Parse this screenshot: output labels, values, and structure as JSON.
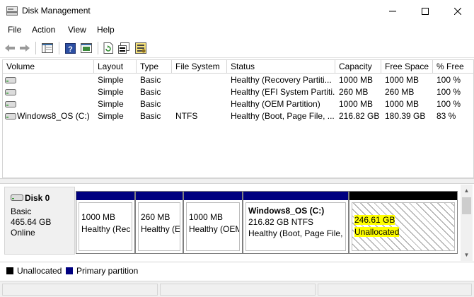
{
  "window": {
    "title": "Disk Management",
    "icon": "disk-management-icon"
  },
  "menu": [
    "File",
    "Action",
    "View",
    "Help"
  ],
  "toolbar": {
    "buttons": [
      "back-arrow-icon",
      "forward-arrow-icon",
      "list-view-icon",
      "help-icon",
      "console-tree-icon",
      "refresh-icon",
      "properties-icon",
      "settings-icon"
    ]
  },
  "volume_list": {
    "columns": [
      "Volume",
      "Layout",
      "Type",
      "File System",
      "Status",
      "Capacity",
      "Free Space",
      "% Free"
    ],
    "rows": [
      {
        "volume": "",
        "layout": "Simple",
        "type": "Basic",
        "fs": "",
        "status": "Healthy (Recovery Partiti...",
        "capacity": "1000 MB",
        "free": "1000 MB",
        "pct": "100 %"
      },
      {
        "volume": "",
        "layout": "Simple",
        "type": "Basic",
        "fs": "",
        "status": "Healthy (EFI System Partiti...",
        "capacity": "260 MB",
        "free": "260 MB",
        "pct": "100 %"
      },
      {
        "volume": "",
        "layout": "Simple",
        "type": "Basic",
        "fs": "",
        "status": "Healthy (OEM Partition)",
        "capacity": "1000 MB",
        "free": "1000 MB",
        "pct": "100 %"
      },
      {
        "volume": "Windows8_OS (C:)",
        "layout": "Simple",
        "type": "Basic",
        "fs": "NTFS",
        "status": "Healthy (Boot, Page File, ...",
        "capacity": "216.82 GB",
        "free": "180.39 GB",
        "pct": "83 %"
      }
    ]
  },
  "disk": {
    "name": "Disk 0",
    "type": "Basic",
    "size": "465.64 GB",
    "state": "Online",
    "partitions": [
      {
        "title": "",
        "size": "1000 MB",
        "status": "Healthy (Rec"
      },
      {
        "title": "",
        "size": "260 MB",
        "status": "Healthy (E"
      },
      {
        "title": "",
        "size": "1000 MB",
        "status": "Healthy (OEM"
      },
      {
        "title": "Windows8_OS  (C:)",
        "size": "216.82 GB NTFS",
        "status": "Healthy (Boot, Page File, C"
      },
      {
        "title": "",
        "size": "246.61 GB",
        "status": "Unallocated"
      }
    ]
  },
  "legend": [
    {
      "label": "Unallocated",
      "color": "#000000"
    },
    {
      "label": "Primary partition",
      "color": "#000080"
    }
  ]
}
